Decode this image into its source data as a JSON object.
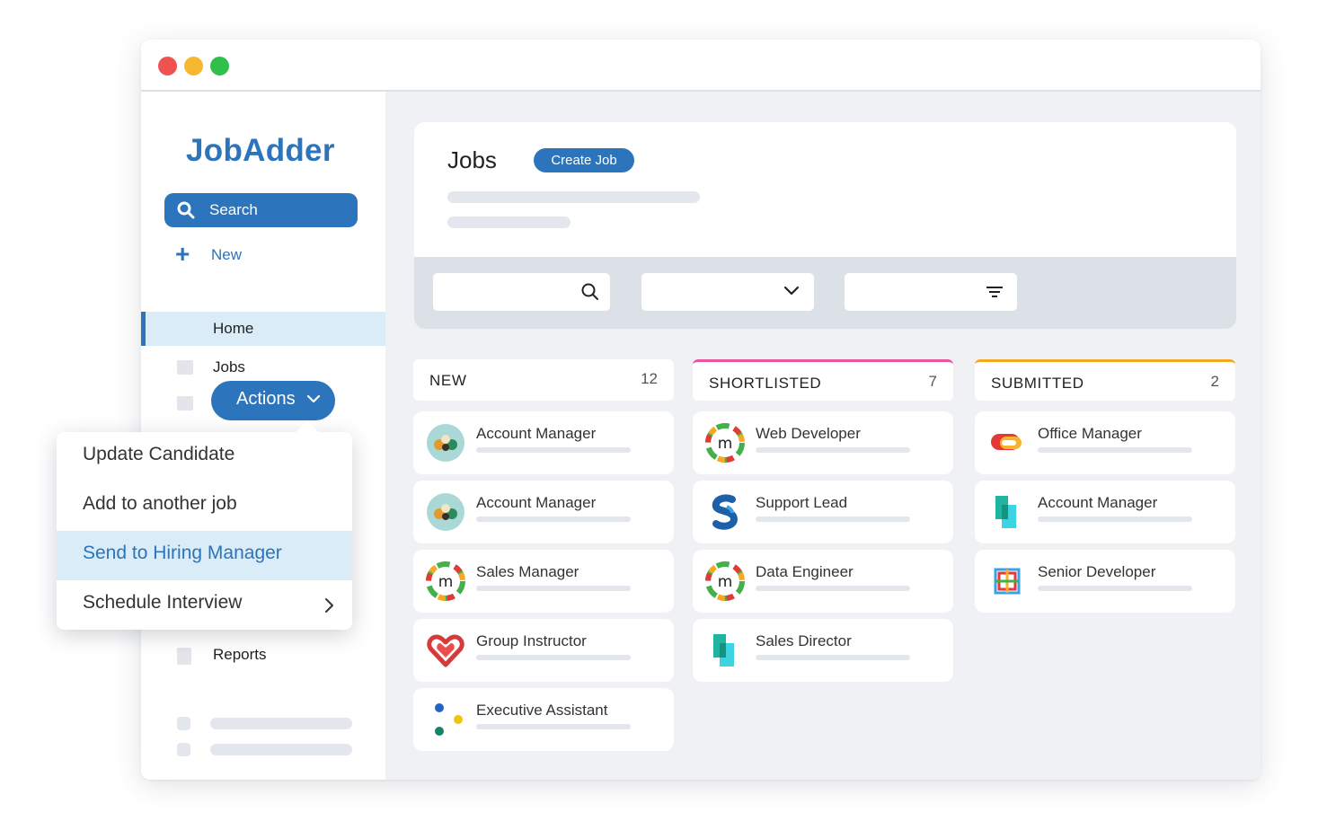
{
  "window": {
    "controls": [
      "close-dot",
      "minimize-dot",
      "maximize-dot"
    ]
  },
  "sidebar": {
    "logo": "JobAdder",
    "search_label": "Search",
    "new_label": "New",
    "nav": {
      "home": "Home",
      "jobs": "Jobs",
      "reports": "Reports"
    }
  },
  "actions_menu": {
    "button_label": "Actions",
    "items": [
      {
        "label": "Update Candidate"
      },
      {
        "label": "Add to another job"
      },
      {
        "label": "Send to Hiring Manager"
      },
      {
        "label": "Schedule Interview"
      }
    ]
  },
  "jobs_panel": {
    "title": "Jobs",
    "create_label": "Create Job"
  },
  "columns": [
    {
      "title": "NEW",
      "count": "12",
      "accent": "",
      "cards": [
        {
          "title": "Account Manager",
          "logo": "wonderful-logo"
        },
        {
          "title": "Account Manager",
          "logo": "wonderful-logo"
        },
        {
          "title": "Sales Manager",
          "logo": "m-logo"
        },
        {
          "title": "Group Instructor",
          "logo": "heart-logo"
        },
        {
          "title": "Executive Assistant",
          "logo": "dots-logo"
        }
      ]
    },
    {
      "title": "SHORTLISTED",
      "count": "7",
      "accent": "#e6579d",
      "cards": [
        {
          "title": "Web Developer",
          "logo": "m-logo"
        },
        {
          "title": "Support Lead",
          "logo": "s-logo"
        },
        {
          "title": "Data Engineer",
          "logo": "m-logo"
        },
        {
          "title": "Sales Director",
          "logo": "blocks-logo"
        }
      ]
    },
    {
      "title": "SUBMITTED",
      "count": "2",
      "accent": "#f2a922",
      "cards": [
        {
          "title": "Office Manager",
          "logo": "chat-logo"
        },
        {
          "title": "Account Manager",
          "logo": "blocks-logo"
        },
        {
          "title": "Senior Developer",
          "logo": "grid-logo"
        }
      ]
    }
  ],
  "colors": {
    "brand": "#2c74bb",
    "highlight": "#d9ecf8",
    "shortlisted": "#e6579d",
    "submitted": "#f2a922"
  }
}
